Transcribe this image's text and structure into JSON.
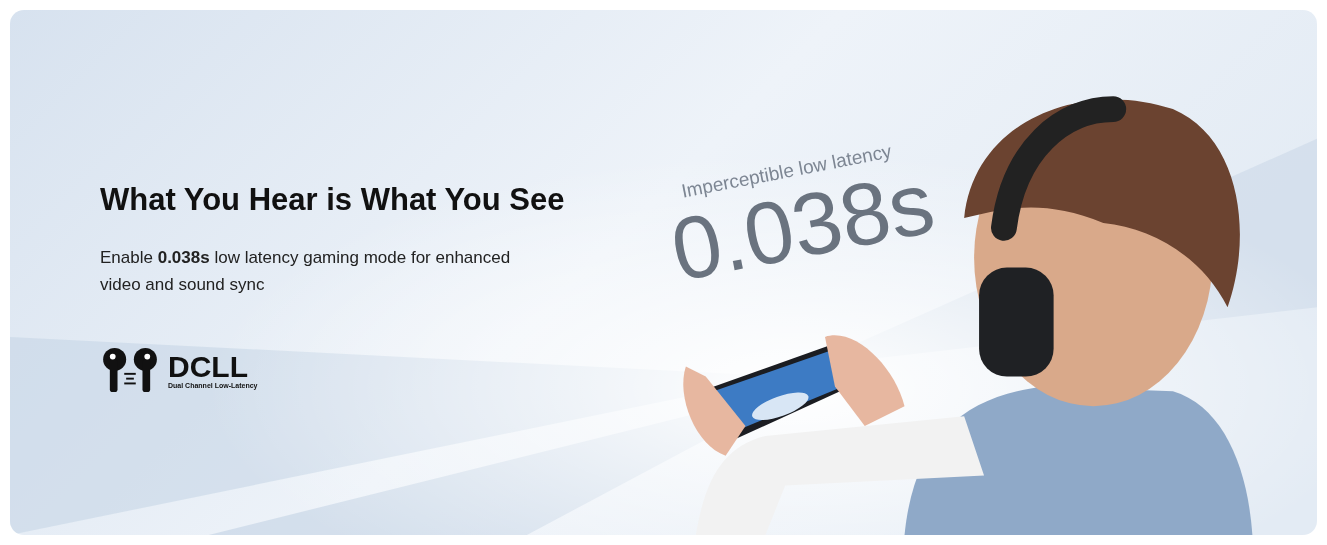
{
  "banner": {
    "heading": "What You Hear is What You See",
    "description": "Enable **0.038s** low latency gaming mode for enhanced video and sound sync",
    "badge": {
      "title": "DCLL",
      "subtitle": "Dual Channel Low-Latency"
    },
    "overlay": {
      "caption": "Imperceptible low latency",
      "figure": "0.038s"
    }
  }
}
